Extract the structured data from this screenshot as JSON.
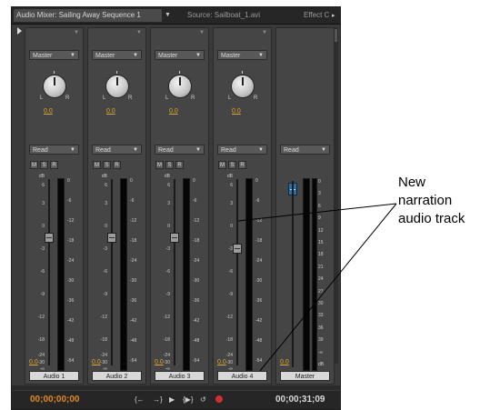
{
  "tabs": [
    {
      "label": "Audio Mixer: Sailing Away Sequence 1",
      "active": true
    },
    {
      "label": "Source: Sailboat_1.avi",
      "active": false
    },
    {
      "label": "Effect C",
      "active": false
    }
  ],
  "strips": [
    {
      "route": "Master",
      "pan_value": "0.0",
      "automation": "Read",
      "m": "M",
      "s": "S",
      "r": "R",
      "volume_value": "0.0",
      "name": "Audio 1"
    },
    {
      "route": "Master",
      "pan_value": "0.0",
      "automation": "Read",
      "m": "M",
      "s": "S",
      "r": "R",
      "volume_value": "0.0",
      "name": "Audio 2"
    },
    {
      "route": "Master",
      "pan_value": "0.0",
      "automation": "Read",
      "m": "M",
      "s": "S",
      "r": "R",
      "volume_value": "0.0",
      "name": "Audio 3"
    },
    {
      "route": "Master",
      "pan_value": "0.0",
      "automation": "Read",
      "m": "M",
      "s": "S",
      "r": "R",
      "volume_value": "0.0",
      "name": "Audio 4"
    }
  ],
  "master": {
    "automation": "Read",
    "volume_value": "0.0",
    "name": "Master"
  },
  "knob_labels": {
    "left": "L",
    "right": "R"
  },
  "fader_scale": [
    "dB",
    "6",
    "3",
    "0",
    "-3",
    "-6",
    "-9",
    "-12",
    "-18",
    "-24",
    "-30",
    "-∞"
  ],
  "meter_scale": [
    "0",
    "-6",
    "-12",
    "-18",
    "-24",
    "-30",
    "-36",
    "-42",
    "-48",
    "-54",
    "dB"
  ],
  "master_scale": [
    "0",
    "3",
    "6",
    "9",
    "12",
    "15",
    "18",
    "21",
    "24",
    "27",
    "30",
    "33",
    "36",
    "39",
    "-∞",
    "dB"
  ],
  "transport": {
    "timecode_in": "00;00;00;00",
    "timecode_out": "00;00;31;09",
    "buttons": [
      "{←",
      "→}",
      "▶",
      "{▶}",
      "↺"
    ]
  },
  "callout": {
    "line1": "New",
    "line2": "narration",
    "line3": "audio track"
  },
  "colors": {
    "panel": "#3a3a3a",
    "strip": "#454545",
    "value_orange": "#e0a830",
    "timecode_orange": "#e08a1e",
    "master_fader": "#2a6fa8"
  }
}
